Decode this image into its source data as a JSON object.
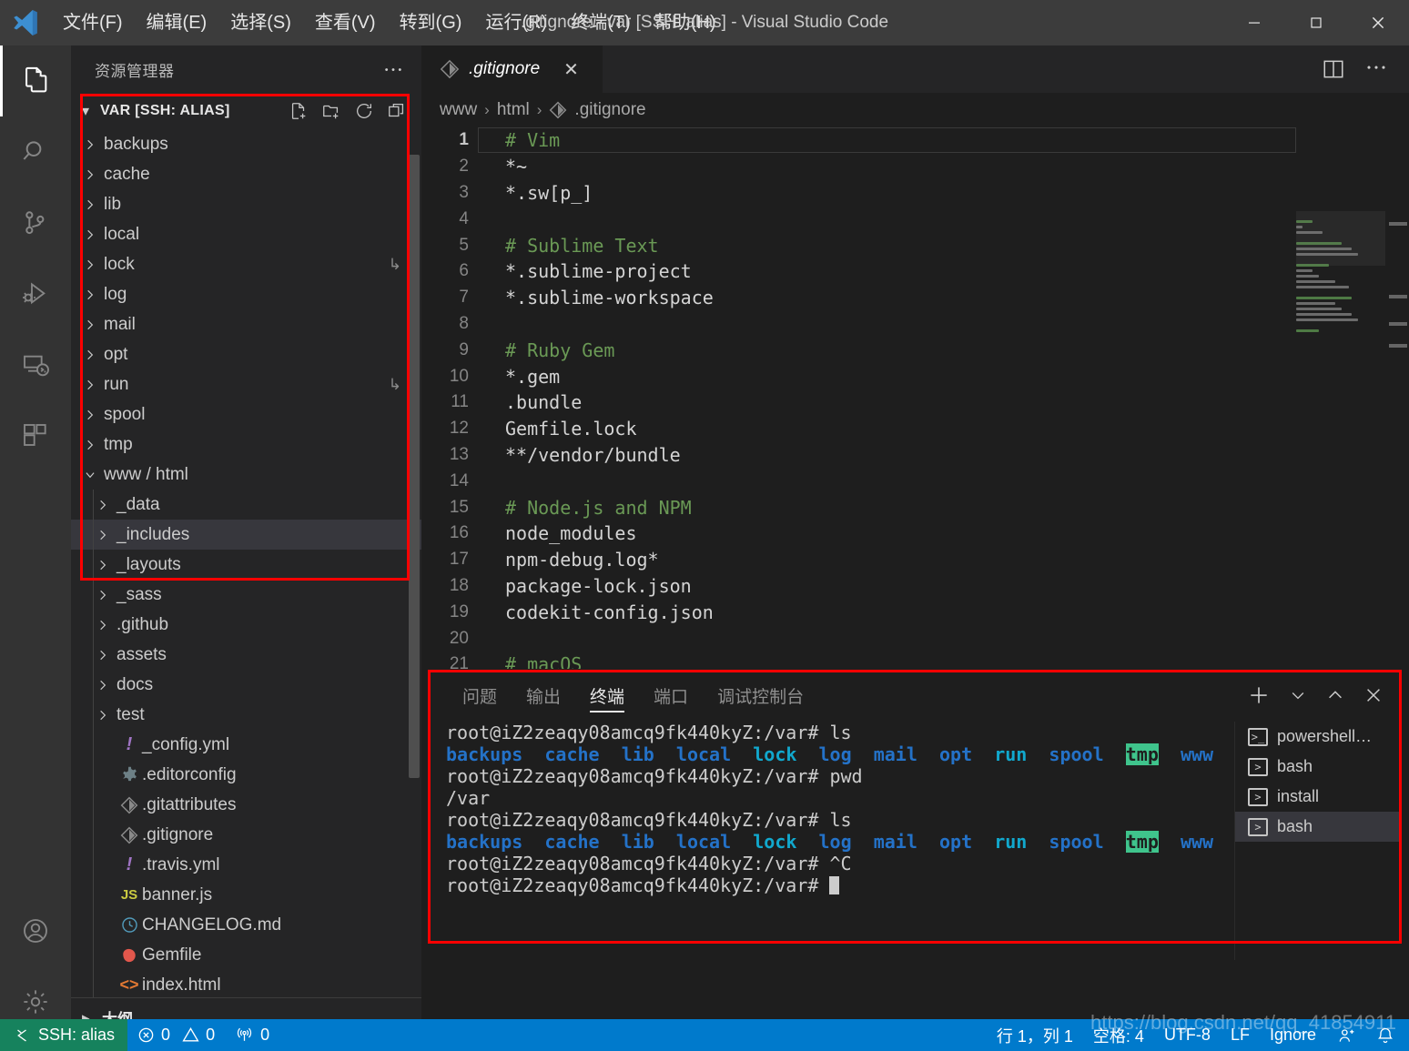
{
  "window": {
    "title": ".gitignore - var [SSH: alias] - Visual Studio Code",
    "minimize_label": "—",
    "maximize_label": "☐",
    "close_label": "✕"
  },
  "menu": {
    "items": [
      {
        "label": "文件(F)",
        "name": "menu-file"
      },
      {
        "label": "编辑(E)",
        "name": "menu-edit"
      },
      {
        "label": "选择(S)",
        "name": "menu-selection"
      },
      {
        "label": "查看(V)",
        "name": "menu-view"
      },
      {
        "label": "转到(G)",
        "name": "menu-go"
      },
      {
        "label": "运行(R)",
        "name": "menu-run"
      },
      {
        "label": "终端(T)",
        "name": "menu-terminal"
      },
      {
        "label": "帮助(H)",
        "name": "menu-help"
      }
    ]
  },
  "activity_bar": {
    "items": [
      {
        "icon": "files-explorer-icon",
        "active": true
      },
      {
        "icon": "search-icon",
        "active": false
      },
      {
        "icon": "source-control-icon",
        "active": false
      },
      {
        "icon": "run-and-debug-icon",
        "active": false
      },
      {
        "icon": "remote-explorer-icon",
        "active": false
      },
      {
        "icon": "extensions-icon",
        "active": false
      }
    ],
    "bottom": [
      {
        "icon": "accounts-icon"
      },
      {
        "icon": "manage-gear-icon"
      }
    ]
  },
  "sidebar": {
    "title": "资源管理器",
    "more_actions": "⋯",
    "section_label": "VAR [SSH: ALIAS]",
    "section_actions": [
      "new-file-icon",
      "new-folder-icon",
      "refresh-icon",
      "collapse-all-icon"
    ],
    "outline_label": "大纲",
    "tree": [
      {
        "label": "backups",
        "kind": "folder",
        "indent": 0,
        "expanded": false,
        "trail": ""
      },
      {
        "label": "cache",
        "kind": "folder",
        "indent": 0,
        "expanded": false,
        "trail": ""
      },
      {
        "label": "lib",
        "kind": "folder",
        "indent": 0,
        "expanded": false,
        "trail": ""
      },
      {
        "label": "local",
        "kind": "folder",
        "indent": 0,
        "expanded": false,
        "trail": ""
      },
      {
        "label": "lock",
        "kind": "folder",
        "indent": 0,
        "expanded": false,
        "trail": "↳"
      },
      {
        "label": "log",
        "kind": "folder",
        "indent": 0,
        "expanded": false,
        "trail": ""
      },
      {
        "label": "mail",
        "kind": "folder",
        "indent": 0,
        "expanded": false,
        "trail": ""
      },
      {
        "label": "opt",
        "kind": "folder",
        "indent": 0,
        "expanded": false,
        "trail": ""
      },
      {
        "label": "run",
        "kind": "folder",
        "indent": 0,
        "expanded": false,
        "trail": "↳"
      },
      {
        "label": "spool",
        "kind": "folder",
        "indent": 0,
        "expanded": false,
        "trail": ""
      },
      {
        "label": "tmp",
        "kind": "folder",
        "indent": 0,
        "expanded": false,
        "trail": ""
      },
      {
        "label": "www / html",
        "kind": "folder",
        "indent": 0,
        "expanded": true,
        "trail": ""
      },
      {
        "label": "_data",
        "kind": "folder",
        "indent": 1,
        "expanded": false,
        "trail": ""
      },
      {
        "label": "_includes",
        "kind": "folder",
        "indent": 1,
        "expanded": false,
        "trail": "",
        "selected": true
      },
      {
        "label": "_layouts",
        "kind": "folder",
        "indent": 1,
        "expanded": false,
        "trail": ""
      },
      {
        "label": "_sass",
        "kind": "folder",
        "indent": 1,
        "expanded": false,
        "trail": ""
      },
      {
        "label": ".github",
        "kind": "folder",
        "indent": 1,
        "expanded": false,
        "trail": ""
      },
      {
        "label": "assets",
        "kind": "folder",
        "indent": 1,
        "expanded": false,
        "trail": ""
      },
      {
        "label": "docs",
        "kind": "folder",
        "indent": 1,
        "expanded": false,
        "trail": ""
      },
      {
        "label": "test",
        "kind": "folder",
        "indent": 1,
        "expanded": false,
        "trail": ""
      },
      {
        "label": "_config.yml",
        "kind": "file",
        "icon": "yaml-icon",
        "indent": 1,
        "trail": ""
      },
      {
        "label": ".editorconfig",
        "kind": "file",
        "icon": "config-gear-icon",
        "indent": 1,
        "trail": ""
      },
      {
        "label": ".gitattributes",
        "kind": "file",
        "icon": "git-icon",
        "indent": 1,
        "trail": ""
      },
      {
        "label": ".gitignore",
        "kind": "file",
        "icon": "git-icon",
        "indent": 1,
        "trail": ""
      },
      {
        "label": ".travis.yml",
        "kind": "file",
        "icon": "yaml-icon",
        "indent": 1,
        "trail": ""
      },
      {
        "label": "banner.js",
        "kind": "file",
        "icon": "js-icon",
        "indent": 1,
        "trail": ""
      },
      {
        "label": "CHANGELOG.md",
        "kind": "file",
        "icon": "changelog-clock-icon",
        "indent": 1,
        "trail": ""
      },
      {
        "label": "Gemfile",
        "kind": "file",
        "icon": "ruby-gem-icon",
        "indent": 1,
        "trail": ""
      },
      {
        "label": "index.html",
        "kind": "file",
        "icon": "html-icon",
        "indent": 1,
        "trail": ""
      }
    ]
  },
  "editor": {
    "tab": {
      "label": ".gitignore",
      "icon": "git-icon",
      "close": "✕"
    },
    "actions": [
      "split-editor-icon",
      "more-actions-icon"
    ],
    "breadcrumb": [
      "www",
      "html",
      ".gitignore"
    ],
    "breadcrumb_separator": "›",
    "breadcrumb_file_icon": "git-icon",
    "lines": [
      {
        "n": 1,
        "text": "# Vim",
        "comment": true,
        "current": true
      },
      {
        "n": 2,
        "text": "*~",
        "comment": false
      },
      {
        "n": 3,
        "text": "*.sw[p_]",
        "comment": false
      },
      {
        "n": 4,
        "text": "",
        "comment": false
      },
      {
        "n": 5,
        "text": "# Sublime Text",
        "comment": true
      },
      {
        "n": 6,
        "text": "*.sublime-project",
        "comment": false
      },
      {
        "n": 7,
        "text": "*.sublime-workspace",
        "comment": false
      },
      {
        "n": 8,
        "text": "",
        "comment": false
      },
      {
        "n": 9,
        "text": "# Ruby Gem",
        "comment": true
      },
      {
        "n": 10,
        "text": "*.gem",
        "comment": false
      },
      {
        "n": 11,
        "text": ".bundle",
        "comment": false
      },
      {
        "n": 12,
        "text": "Gemfile.lock",
        "comment": false
      },
      {
        "n": 13,
        "text": "**/vendor/bundle",
        "comment": false
      },
      {
        "n": 14,
        "text": "",
        "comment": false
      },
      {
        "n": 15,
        "text": "# Node.js and NPM",
        "comment": true
      },
      {
        "n": 16,
        "text": "node_modules",
        "comment": false
      },
      {
        "n": 17,
        "text": "npm-debug.log*",
        "comment": false
      },
      {
        "n": 18,
        "text": "package-lock.json",
        "comment": false
      },
      {
        "n": 19,
        "text": "codekit-config.json",
        "comment": false
      },
      {
        "n": 20,
        "text": "",
        "comment": false
      },
      {
        "n": 21,
        "text": "# macOS",
        "comment": true
      }
    ]
  },
  "panel": {
    "tabs": [
      {
        "label": "问题",
        "active": false,
        "name": "tab-problems"
      },
      {
        "label": "输出",
        "active": false,
        "name": "tab-output"
      },
      {
        "label": "终端",
        "active": true,
        "name": "tab-terminal"
      },
      {
        "label": "端口",
        "active": false,
        "name": "tab-ports"
      },
      {
        "label": "调试控制台",
        "active": false,
        "name": "tab-debug-console"
      }
    ],
    "actions": [
      "new-terminal-icon",
      "chevron-down-icon",
      "maximize-panel-icon",
      "close-panel-icon"
    ],
    "terminal": {
      "prompt": "root@iZ2zeaqy08amcq9fk440kyZ:/var# ",
      "lines": [
        {
          "type": "prompt",
          "command": "ls"
        },
        {
          "type": "ls"
        },
        {
          "type": "prompt",
          "command": "pwd"
        },
        {
          "type": "output",
          "text": "/var"
        },
        {
          "type": "prompt",
          "command": "ls"
        },
        {
          "type": "ls"
        },
        {
          "type": "prompt",
          "command": "^C"
        },
        {
          "type": "prompt",
          "command": "",
          "cursor": true
        }
      ],
      "ls_entries": [
        {
          "name": "backups",
          "color": "blue"
        },
        {
          "name": "cache",
          "color": "blue"
        },
        {
          "name": "lib",
          "color": "blue"
        },
        {
          "name": "local",
          "color": "blue"
        },
        {
          "name": "lock",
          "color": "cyan"
        },
        {
          "name": "log",
          "color": "blue"
        },
        {
          "name": "mail",
          "color": "blue"
        },
        {
          "name": "opt",
          "color": "blue"
        },
        {
          "name": "run",
          "color": "cyan"
        },
        {
          "name": "spool",
          "color": "blue"
        },
        {
          "name": "tmp",
          "color": "greenbg"
        },
        {
          "name": "www",
          "color": "blue"
        }
      ]
    },
    "shell_list": [
      {
        "label": "powershell…",
        "icon": "powershell-icon",
        "active": false
      },
      {
        "label": "bash",
        "icon": "terminal-icon",
        "active": false
      },
      {
        "label": "install",
        "icon": "terminal-icon",
        "active": false
      },
      {
        "label": "bash",
        "icon": "terminal-icon",
        "active": true
      }
    ]
  },
  "status_bar": {
    "remote": {
      "label": "SSH: alias",
      "icon": "remote-indicator-icon"
    },
    "errors": "0",
    "warnings": "0",
    "ports": "0",
    "right": [
      {
        "label": "行 1，列 1",
        "name": "status-line-col"
      },
      {
        "label": "空格: 4",
        "name": "status-indentation"
      },
      {
        "label": "UTF-8",
        "name": "status-encoding"
      },
      {
        "label": "LF",
        "name": "status-eol"
      },
      {
        "label": "Ignore",
        "name": "status-language-mode"
      }
    ],
    "feedback_icon": "feedback-person-icon",
    "bell_icon": "notifications-bell-icon"
  },
  "watermark": "https://blog.csdn.net/qq_41854911",
  "colors": {
    "accent": "#007acc",
    "remote_green": "#16825d",
    "annotation_red": "#ff0000",
    "comment_green": "#6a9955",
    "terminal_blue": "#2472c8",
    "terminal_cyan": "#11a8cd",
    "tmp_bg_green": "#3fc48c"
  }
}
